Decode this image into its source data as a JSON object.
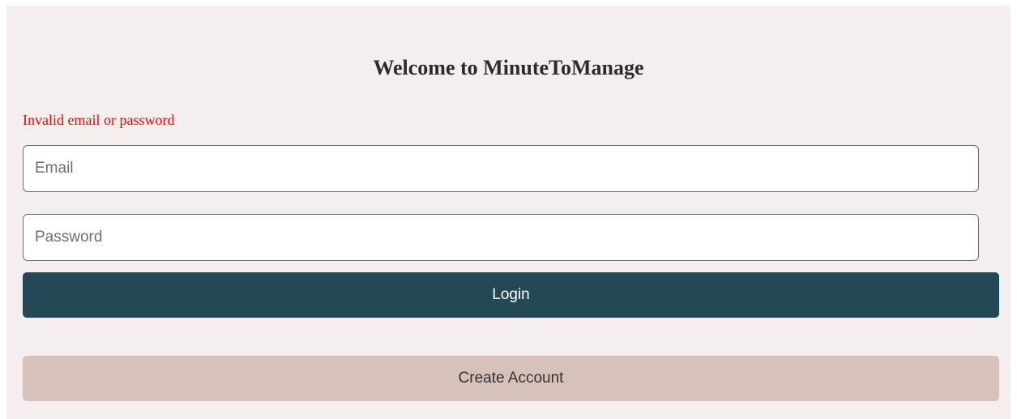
{
  "login_form": {
    "title": "Welcome to MinuteToManage",
    "error_message": "Invalid email or password",
    "email": {
      "placeholder": "Email",
      "value": ""
    },
    "password": {
      "placeholder": "Password",
      "value": ""
    },
    "login_label": "Login",
    "create_account_label": "Create Account"
  },
  "colors": {
    "panel_background": "#f4efee",
    "error_text": "#ff0000",
    "login_button": "#234856",
    "create_account_button": "#d6c1bb",
    "input_border": "#5d6f80"
  }
}
